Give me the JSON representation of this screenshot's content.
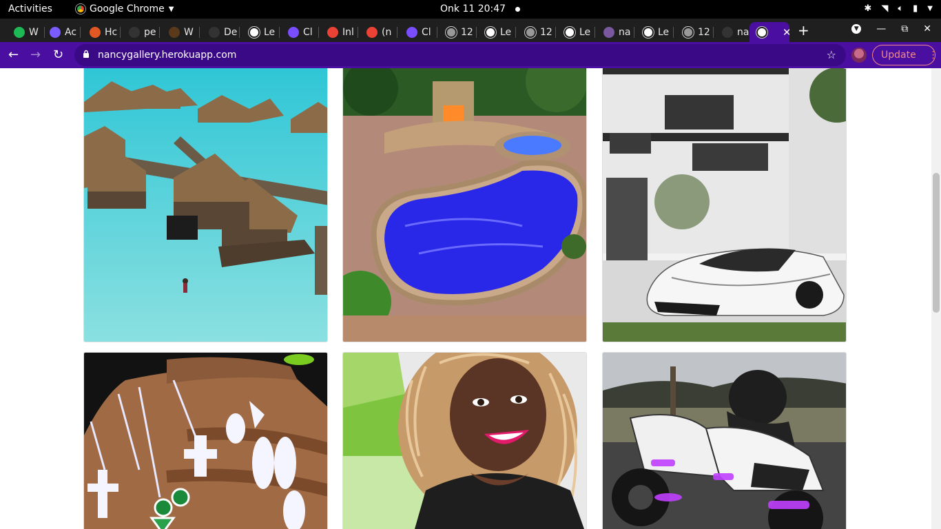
{
  "system_bar": {
    "activities": "Activities",
    "app_name": "Google Chrome",
    "clock": "Onk 11  20:47"
  },
  "tabs": [
    {
      "label": "W",
      "favicon": "play-icon",
      "color": "#1db954"
    },
    {
      "label": "Ac",
      "favicon": "app-icon",
      "color": "#7b5cff"
    },
    {
      "label": "Hc",
      "favicon": "hotel-icon",
      "color": "#e25822"
    },
    {
      "label": "pe",
      "favicon": "github-icon",
      "color": "#333333"
    },
    {
      "label": "W",
      "favicon": "tree-icon",
      "color": "#5a3a1a"
    },
    {
      "label": "De",
      "favicon": "github-icon",
      "color": "#333333"
    },
    {
      "label": "Le",
      "favicon": "globe-icon",
      "color": "#ffffff"
    },
    {
      "label": "Cl",
      "favicon": "cloud-icon",
      "color": "#7a4dff"
    },
    {
      "label": "Inl",
      "favicon": "gmail-icon",
      "color": "#ea4335"
    },
    {
      "label": "(n",
      "favicon": "gmail-icon",
      "color": "#ea4335"
    },
    {
      "label": "Cl",
      "favicon": "cloud-icon",
      "color": "#7a4dff"
    },
    {
      "label": "12",
      "favicon": "globe-icon",
      "color": "#999999"
    },
    {
      "label": "Le",
      "favicon": "globe-icon",
      "color": "#ffffff"
    },
    {
      "label": "12",
      "favicon": "globe-icon",
      "color": "#999999"
    },
    {
      "label": "Le",
      "favicon": "globe-icon",
      "color": "#ffffff"
    },
    {
      "label": "na",
      "favicon": "heroku-icon",
      "color": "#79589f"
    },
    {
      "label": "Le",
      "favicon": "globe-icon",
      "color": "#ffffff"
    },
    {
      "label": "12",
      "favicon": "globe-icon",
      "color": "#999999"
    },
    {
      "label": "na",
      "favicon": "github-icon",
      "color": "#333333"
    },
    {
      "label": "",
      "favicon": "globe-icon",
      "color": "#ffffff",
      "active": true
    }
  ],
  "toolbar": {
    "url": "nancygallery.herokuapp.com",
    "update_label": "Update"
  },
  "gallery": [
    {
      "name": "overwater-bungalows-photo"
    },
    {
      "name": "backyard-pool-photo"
    },
    {
      "name": "white-house-sports-car-photo"
    },
    {
      "name": "jewelry-rings-necklaces-photo"
    },
    {
      "name": "smiling-woman-selfie-photo"
    },
    {
      "name": "purple-lit-motorcycle-photo"
    }
  ]
}
